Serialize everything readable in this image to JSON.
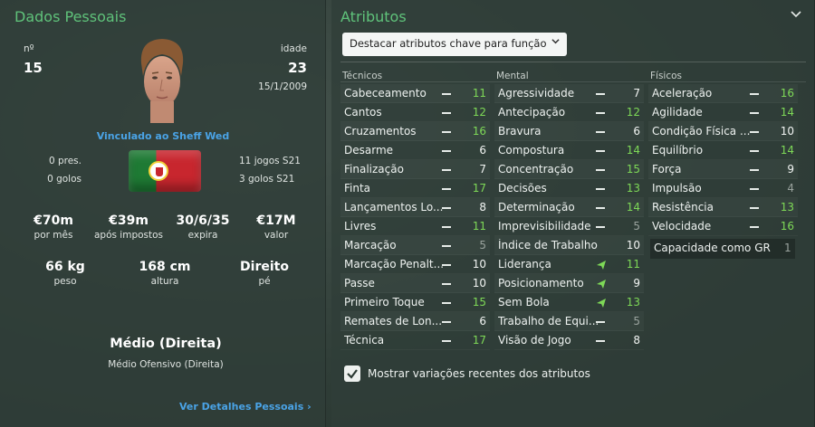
{
  "personal": {
    "title": "Dados Pessoais",
    "number_label": "nº",
    "number": "15",
    "age_label": "idade",
    "age": "23",
    "date": "15/1/2009",
    "loan_text": "Vinculado ao Sheff Wed",
    "left_stats": [
      "0 pres.",
      "0 golos"
    ],
    "right_stats": [
      "11 jogos S21",
      "3 golos S21"
    ],
    "money": [
      {
        "value": "€70m",
        "label": "por mês"
      },
      {
        "value": "€39m",
        "label": "após impostos"
      },
      {
        "value": "30/6/35",
        "label": "expira"
      },
      {
        "value": "€17M",
        "label": "valor"
      }
    ],
    "body": [
      {
        "value": "66 kg",
        "label": "peso"
      },
      {
        "value": "168 cm",
        "label": "altura"
      },
      {
        "value": "Direito",
        "label": "pé"
      }
    ],
    "position_main": "Médio (Direita)",
    "position_sub": "Médio Ofensivo (Direita)",
    "details_link": "Ver Detalhes Pessoais"
  },
  "attributes": {
    "title": "Atributos",
    "dropdown_label": "Destacar atributos chave para função",
    "columns": [
      {
        "header": "Técnicos",
        "rows": [
          {
            "name": "Cabeceamento",
            "value": "11",
            "color": "green",
            "trend": "flat"
          },
          {
            "name": "Cantos",
            "value": "12",
            "color": "green",
            "trend": "flat"
          },
          {
            "name": "Cruzamentos",
            "value": "16",
            "color": "green",
            "trend": "flat"
          },
          {
            "name": "Desarme",
            "value": "6",
            "color": "white",
            "trend": "flat"
          },
          {
            "name": "Finalização",
            "value": "7",
            "color": "white",
            "trend": "flat"
          },
          {
            "name": "Finta",
            "value": "17",
            "color": "green",
            "trend": "flat"
          },
          {
            "name": "Lançamentos Lo...",
            "value": "8",
            "color": "white",
            "trend": "flat"
          },
          {
            "name": "Livres",
            "value": "11",
            "color": "green",
            "trend": "flat"
          },
          {
            "name": "Marcação",
            "value": "5",
            "color": "grey",
            "trend": "flat"
          },
          {
            "name": "Marcação Penalt...",
            "value": "10",
            "color": "white",
            "trend": "flat"
          },
          {
            "name": "Passe",
            "value": "10",
            "color": "white",
            "trend": "flat"
          },
          {
            "name": "Primeiro Toque",
            "value": "15",
            "color": "green",
            "trend": "flat"
          },
          {
            "name": "Remates de Lon...",
            "value": "6",
            "color": "white",
            "trend": "flat"
          },
          {
            "name": "Técnica",
            "value": "17",
            "color": "green",
            "trend": "flat"
          }
        ]
      },
      {
        "header": "Mental",
        "rows": [
          {
            "name": "Agressividade",
            "value": "7",
            "color": "white",
            "trend": "flat"
          },
          {
            "name": "Antecipação",
            "value": "12",
            "color": "green",
            "trend": "flat"
          },
          {
            "name": "Bravura",
            "value": "6",
            "color": "white",
            "trend": "flat"
          },
          {
            "name": "Compostura",
            "value": "14",
            "color": "green",
            "trend": "flat"
          },
          {
            "name": "Concentração",
            "value": "15",
            "color": "green",
            "trend": "flat"
          },
          {
            "name": "Decisões",
            "value": "13",
            "color": "green",
            "trend": "flat"
          },
          {
            "name": "Determinação",
            "value": "14",
            "color": "green",
            "trend": "flat"
          },
          {
            "name": "Imprevisibilidade",
            "value": "5",
            "color": "grey",
            "trend": "flat"
          },
          {
            "name": "Índice de Trabalho",
            "value": "10",
            "color": "white",
            "trend": "none"
          },
          {
            "name": "Liderança",
            "value": "11",
            "color": "green",
            "trend": "up"
          },
          {
            "name": "Posicionamento",
            "value": "9",
            "color": "white",
            "trend": "up"
          },
          {
            "name": "Sem Bola",
            "value": "13",
            "color": "green",
            "trend": "up"
          },
          {
            "name": "Trabalho de Equi...",
            "value": "5",
            "color": "grey",
            "trend": "flat"
          },
          {
            "name": "Visão de Jogo",
            "value": "8",
            "color": "white",
            "trend": "flat"
          }
        ]
      },
      {
        "header": "Físicos",
        "rows": [
          {
            "name": "Aceleração",
            "value": "16",
            "color": "green",
            "trend": "flat"
          },
          {
            "name": "Agilidade",
            "value": "14",
            "color": "green",
            "trend": "flat"
          },
          {
            "name": "Condição Física ...",
            "value": "10",
            "color": "white",
            "trend": "flat"
          },
          {
            "name": "Equilíbrio",
            "value": "14",
            "color": "green",
            "trend": "flat"
          },
          {
            "name": "Força",
            "value": "9",
            "color": "white",
            "trend": "flat"
          },
          {
            "name": "Impulsão",
            "value": "4",
            "color": "grey",
            "trend": "flat"
          },
          {
            "name": "Resistência",
            "value": "13",
            "color": "green",
            "trend": "flat"
          },
          {
            "name": "Velocidade",
            "value": "16",
            "color": "green",
            "trend": "flat"
          }
        ]
      }
    ],
    "gr_label": "Capacidade como GR",
    "gr_value": "1",
    "show_changes_label": "Mostrar variações recentes dos atributos",
    "show_changes_checked": true
  },
  "colors": {
    "green_title": "#5fc27a",
    "value_green": "#7ed957",
    "link_blue": "#4aa3e6"
  }
}
